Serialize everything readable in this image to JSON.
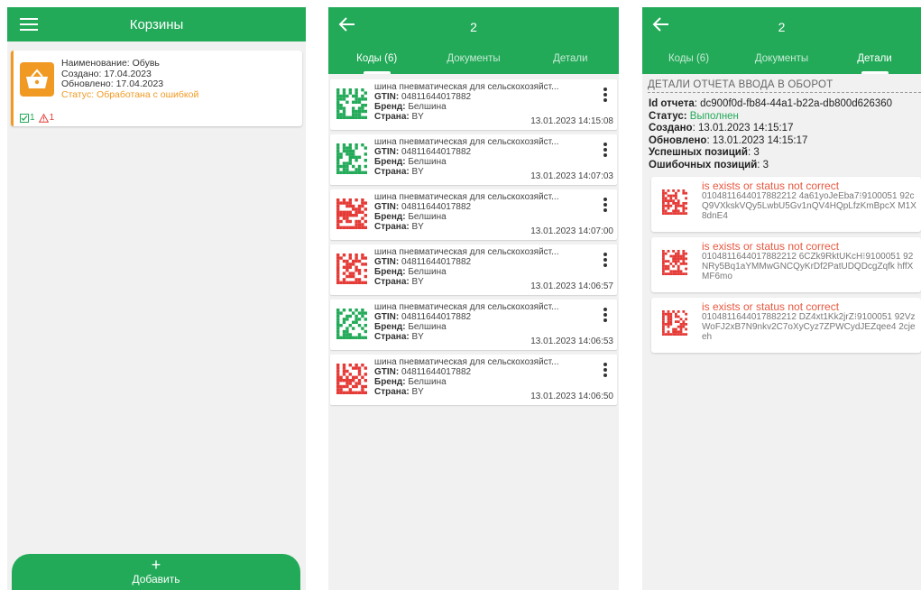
{
  "colors": {
    "brand": "#22aa58",
    "warning": "#f19a23",
    "error": "#e53935"
  },
  "screen1": {
    "title": "Корзины",
    "basket": {
      "name": "Наименование: Обувь",
      "created": "Создано: 17.04.2023",
      "updated": "Обновлено: 17.04.2023",
      "status_label": "Статус:",
      "status_value": "Обработана с ошибкой",
      "ok_count": "1",
      "error_count": "1",
      "icon": "basket-icon"
    },
    "add_plus": "+",
    "add_label": "Добавить"
  },
  "screen2": {
    "title": "2",
    "tabs": [
      "Коды (6)",
      "Документы",
      "Детали"
    ],
    "gtin_label": "GTIN:",
    "brand_label": "Бренд:",
    "country_label": "Страна:",
    "codes": [
      {
        "name": "шина пневматическая для сельскохозяйст...",
        "gtin": "04811644017882",
        "brand": "Белшина",
        "country": "BY",
        "date": "13.01.2023 14:15:08",
        "status": "ok"
      },
      {
        "name": "шина пневматическая для сельскохозяйст...",
        "gtin": "04811644017882",
        "brand": "Белшина",
        "country": "BY",
        "date": "13.01.2023 14:07:03",
        "status": "ok"
      },
      {
        "name": "шина пневматическая для сельскохозяйст...",
        "gtin": "04811644017882",
        "brand": "Белшина",
        "country": "BY",
        "date": "13.01.2023 14:07:00",
        "status": "error"
      },
      {
        "name": "шина пневматическая для сельскохозяйст...",
        "gtin": "04811644017882",
        "brand": "Белшина",
        "country": "BY",
        "date": "13.01.2023 14:06:57",
        "status": "error"
      },
      {
        "name": "шина пневматическая для сельскохозяйст...",
        "gtin": "04811644017882",
        "brand": "Белшина",
        "country": "BY",
        "date": "13.01.2023 14:06:53",
        "status": "ok"
      },
      {
        "name": "шина пневматическая для сельскохозяйст...",
        "gtin": "04811644017882",
        "brand": "Белшина",
        "country": "BY",
        "date": "13.01.2023 14:06:50",
        "status": "error"
      }
    ]
  },
  "screen3": {
    "title": "2",
    "tabs": [
      "Коды (6)",
      "Документы",
      "Детали"
    ],
    "section_title": "ДЕТАЛИ ОТЧЕТА ВВОДА В ОБОРОТ",
    "report_id_label": "Id отчета",
    "report_id": ": dc900f0d-fb84-44a1-b22a-db800d626360",
    "status_label": "Статус:",
    "status_value": "Выполнен",
    "created_label": "Создано",
    "created_value": ": 13.01.2023 14:15:17",
    "updated_label": "Обновлено",
    "updated_value": ": 13.01.2023 14:15:17",
    "success_label": "Успешных позиций",
    "success_value": ": 3",
    "errors_label": "Ошибочных позиций",
    "errors_value": ": 3",
    "errors": [
      {
        "message": "is exists or status not correct",
        "code": "0104811644017882212 4a61yoJeEba7⁝9100051 92cQ9VXkskVQy5LwbU5Gv1nQV4HQpLfzKmBpcX M1X8dnE4"
      },
      {
        "message": "is exists or status not correct",
        "code": "0104811644017882212 6CZk9RktUKcH⁝9100051 92NRy5Bq1aYMMwGNCQyKrDf2PatUDQDcgZqfk hffXMF6mo"
      },
      {
        "message": "is exists or status not correct",
        "code": "0104811644017882212 DZ4xt1Kk2jrZ⁝9100051 92VzWoFJ2xB7N9nkv2C7oXyCyz7ZPWCydJEZqee4 2cjeeh"
      }
    ]
  }
}
